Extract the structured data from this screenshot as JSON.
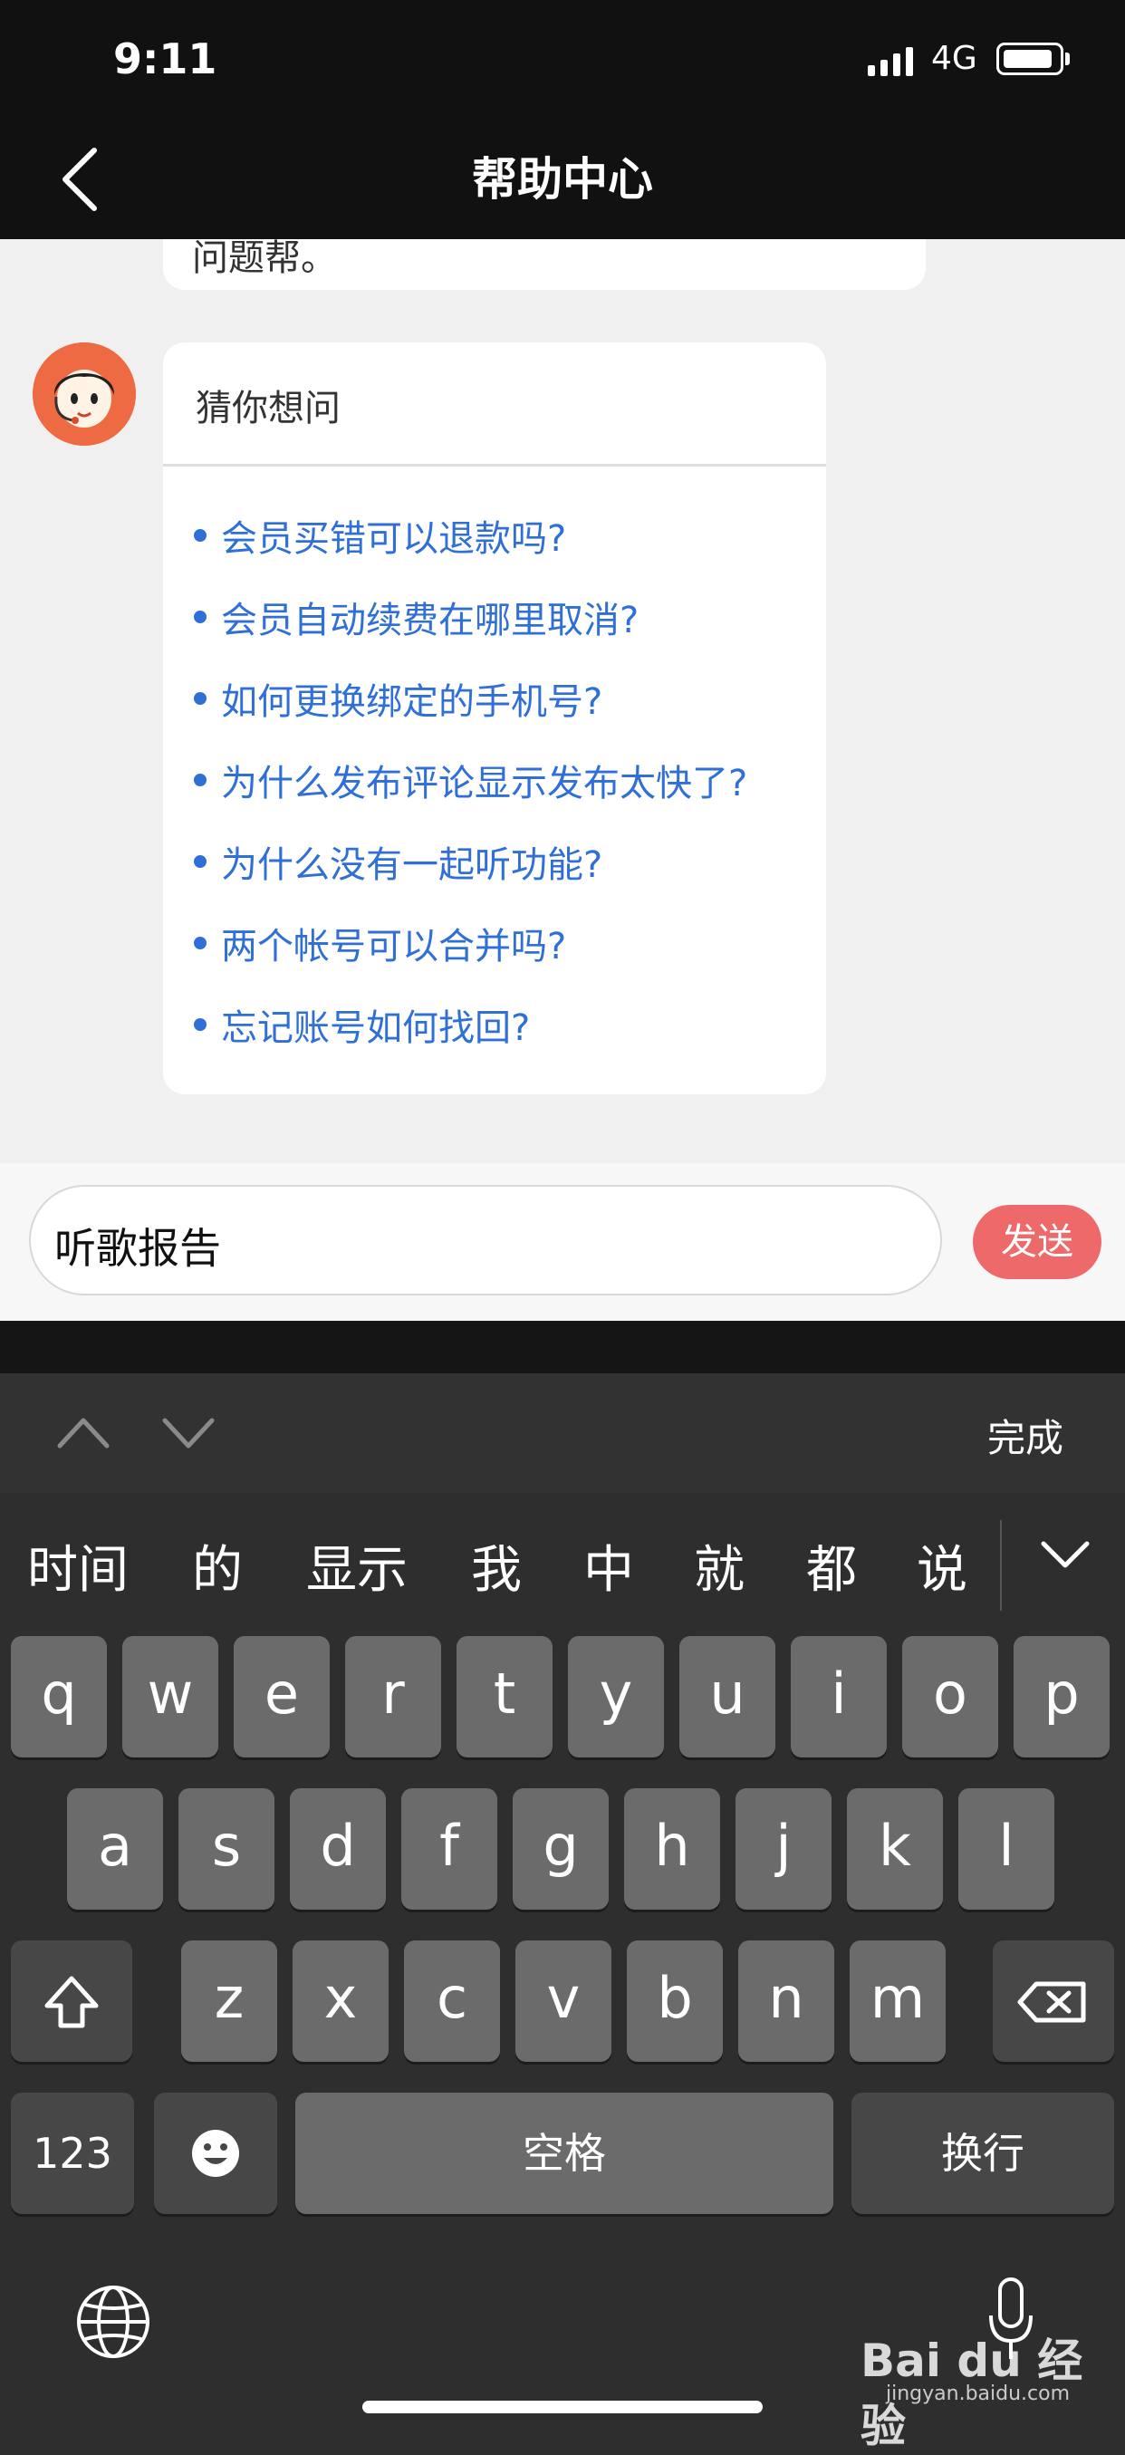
{
  "status_bar": {
    "time": "9:11",
    "network": "4G"
  },
  "nav": {
    "title": "帮助中心"
  },
  "chat": {
    "prev_message_fragment": "问题帮。",
    "suggest_card": {
      "header": "猜你想问",
      "questions": [
        "会员买错可以退款吗?",
        "会员自动续费在哪里取消?",
        "如何更换绑定的手机号?",
        "为什么发布评论显示发布太快了?",
        "为什么没有一起听功能?",
        "两个帐号可以合并吗?",
        "忘记账号如何找回?"
      ]
    }
  },
  "input_bar": {
    "value": "听歌报告",
    "send_label": "发送"
  },
  "keyboard": {
    "done_label": "完成",
    "candidates": [
      "时间",
      "的",
      "显示",
      "我",
      "中",
      "就",
      "都",
      "说"
    ],
    "row1": [
      "q",
      "w",
      "e",
      "r",
      "t",
      "y",
      "u",
      "i",
      "o",
      "p"
    ],
    "row2": [
      "a",
      "s",
      "d",
      "f",
      "g",
      "h",
      "j",
      "k",
      "l"
    ],
    "row3": [
      "z",
      "x",
      "c",
      "v",
      "b",
      "n",
      "m"
    ],
    "numbers_label": "123",
    "space_label": "空格",
    "return_label": "换行"
  },
  "watermark": {
    "main": "Bai du 经验",
    "sub": "jingyan.baidu.com"
  },
  "colors": {
    "accent_red": "#ee6a6a",
    "link_blue": "#2f6fd6",
    "avatar_orange": "#ee6a43"
  }
}
